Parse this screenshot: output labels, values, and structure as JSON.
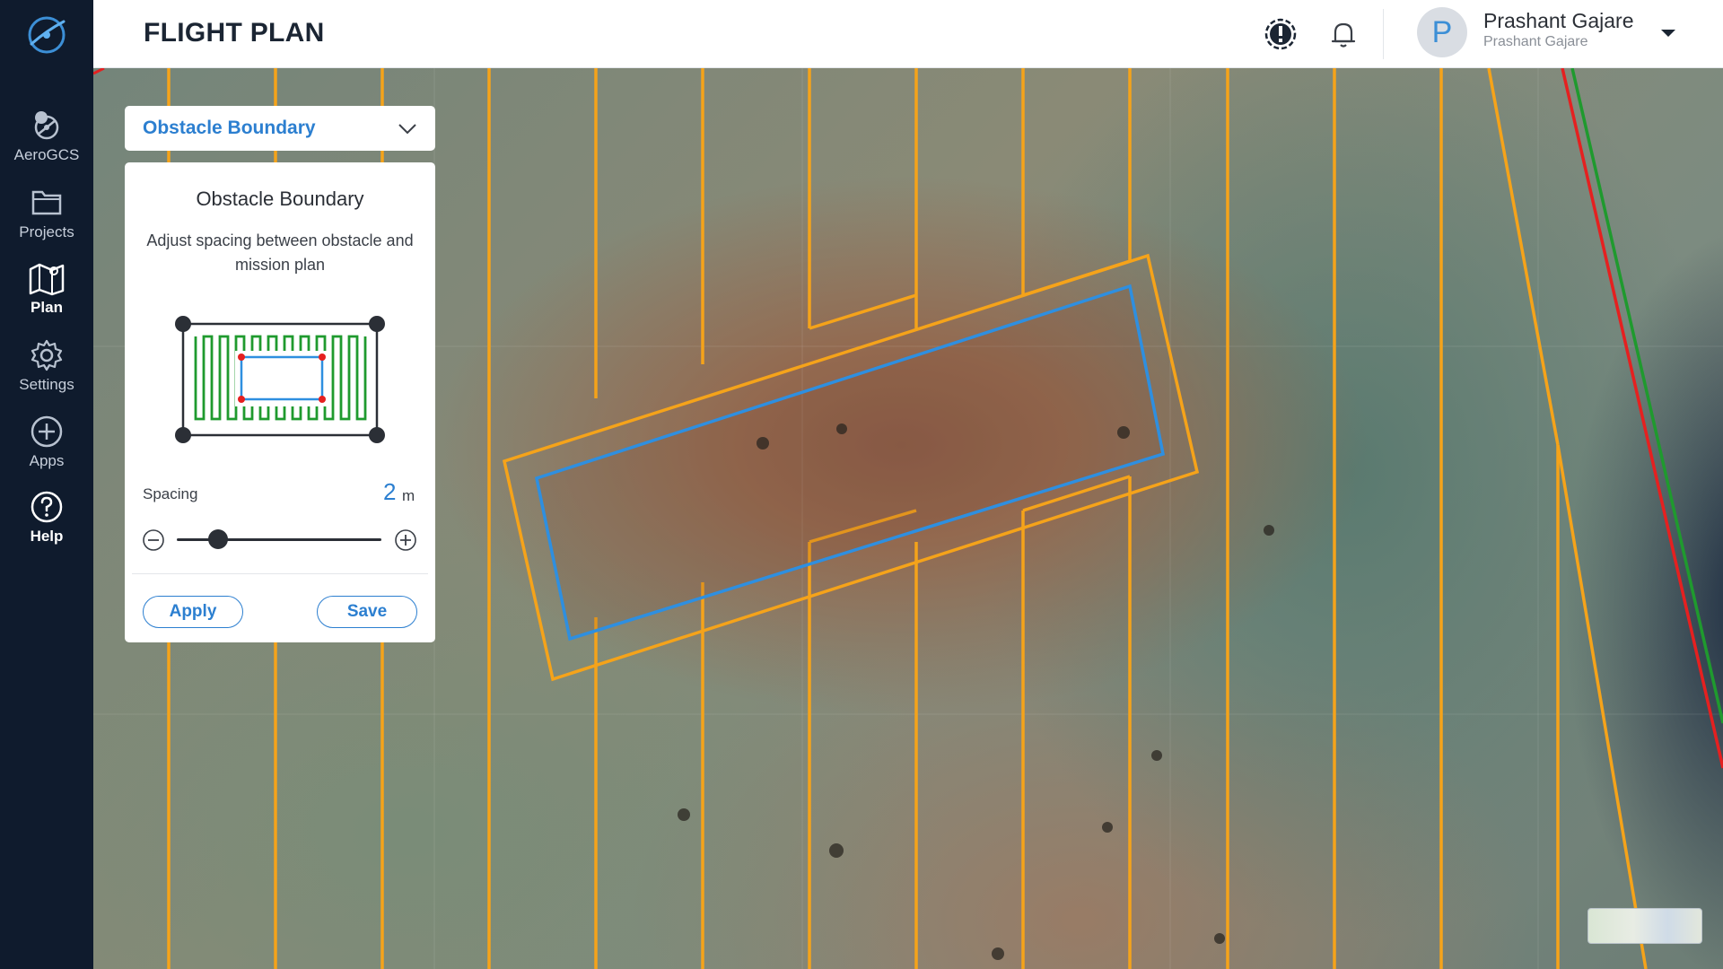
{
  "app": {
    "title": "FLIGHT PLAN"
  },
  "sidebar": {
    "items": [
      {
        "label": "AeroGCS",
        "icon": "drone-icon"
      },
      {
        "label": "Projects",
        "icon": "folder-icon"
      },
      {
        "label": "Plan",
        "icon": "map-icon",
        "active": true
      },
      {
        "label": "Settings",
        "icon": "gear-icon"
      },
      {
        "label": "Apps",
        "icon": "plus-circle-icon"
      },
      {
        "label": "Help",
        "icon": "help-icon"
      }
    ]
  },
  "header": {
    "user": {
      "initial": "P",
      "name": "Prashant Gajare",
      "subtitle": "Prashant Gajare"
    }
  },
  "panel": {
    "dropdown_label": "Obstacle Boundary",
    "title": "Obstacle Boundary",
    "description": "Adjust spacing between obstacle and mission plan",
    "spacing_label": "Spacing",
    "spacing_value": "2",
    "spacing_unit": "m",
    "slider_fraction": 0.2,
    "apply_label": "Apply",
    "save_label": "Save"
  },
  "colors": {
    "accent": "#2c7fd0",
    "sidebar_bg": "#0f1b2d",
    "mission_line": "#f5a31a",
    "obstacle": "#2e8fe0",
    "geofence_red": "#e52020",
    "geofence_green": "#1f9a2e"
  }
}
